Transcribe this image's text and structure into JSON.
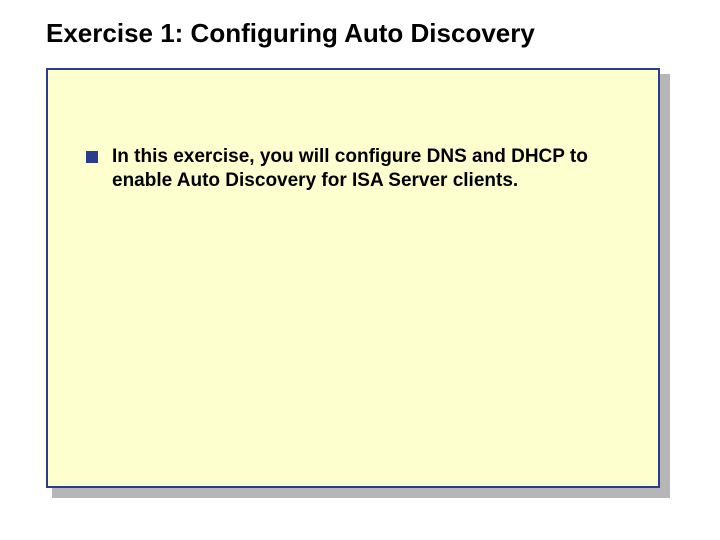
{
  "title": "Exercise 1: Configuring Auto Discovery",
  "bullets": [
    {
      "text": "In this exercise, you will configure DNS and DHCP to enable Auto Discovery for ISA Server clients."
    }
  ]
}
